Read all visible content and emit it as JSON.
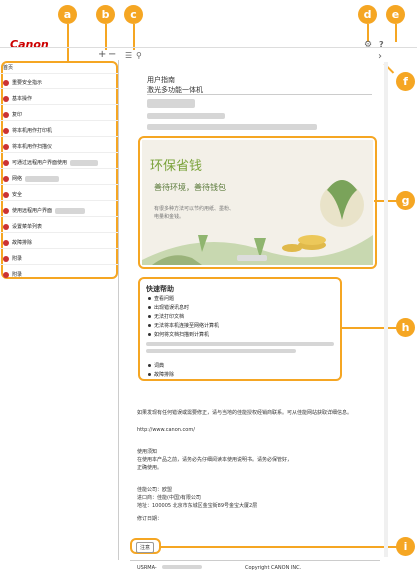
{
  "header": {
    "logo": "Canon",
    "settings_icon": "gear-icon",
    "help_label": "?"
  },
  "toolbar": {
    "zoom_in": "+",
    "zoom_out": "−",
    "list_icon": "☰",
    "search_icon": "⚲",
    "next_arrow": "›"
  },
  "callouts": [
    "a",
    "b",
    "c",
    "d",
    "e",
    "f",
    "g",
    "h",
    "i"
  ],
  "sidebar": {
    "items": [
      {
        "label": "首页"
      },
      {
        "label": "重要安全指示"
      },
      {
        "label": "基本操作"
      },
      {
        "label": "复印"
      },
      {
        "label": "将本机用作打印机"
      },
      {
        "label": "将本机用作扫描仪"
      },
      {
        "label": "可通过远程用户界面使用"
      },
      {
        "label": "网络"
      },
      {
        "label": "安全"
      },
      {
        "label": "使用远程用户界面"
      },
      {
        "label": "设置菜单列表"
      },
      {
        "label": "故障排除"
      },
      {
        "label": "附录"
      },
      {
        "label": "附录"
      }
    ]
  },
  "main": {
    "doc_title": "用户指南",
    "doc_subtitle": "激光多功能一体机",
    "banner_title": "环保省钱",
    "banner_subtitle": "善待环境，善待钱包",
    "banner_body_1": "有很多种方法可以节约用纸、墨粉、",
    "banner_body_2": "电量和金钱。",
    "quick_title": "快速帮助",
    "quick_items": [
      "查看问题",
      "出现错误讯息时",
      "无法打印文档",
      "无法将本机连接至网络计算机",
      "如何将文档扫描到计算机"
    ],
    "quick_links": [
      "词典",
      "故障排除"
    ],
    "notice_1": "如果发现有任何错误或需要修正，请与当地的佳能授权经销商联系。可从佳能网站获取详细信息。",
    "notice_2": "http://www.canon.com/",
    "usage_title": "使用须知",
    "usage_text": "在使用本产品之前，请务必先仔细阅读本使用说明书。请务必保管好，",
    "usage_text_2": "正确使用。",
    "company_1": "佳能公司：欧盟",
    "company_2": "进口商：佳能(中国)有限公司",
    "company_3": "地址：100005 北京市东城区金宝街89号金宝大厦2层",
    "revision": "修订日期：",
    "notice_button": "注意",
    "footer_code": "USRMA-",
    "copyright": "Copyright CANON INC."
  }
}
